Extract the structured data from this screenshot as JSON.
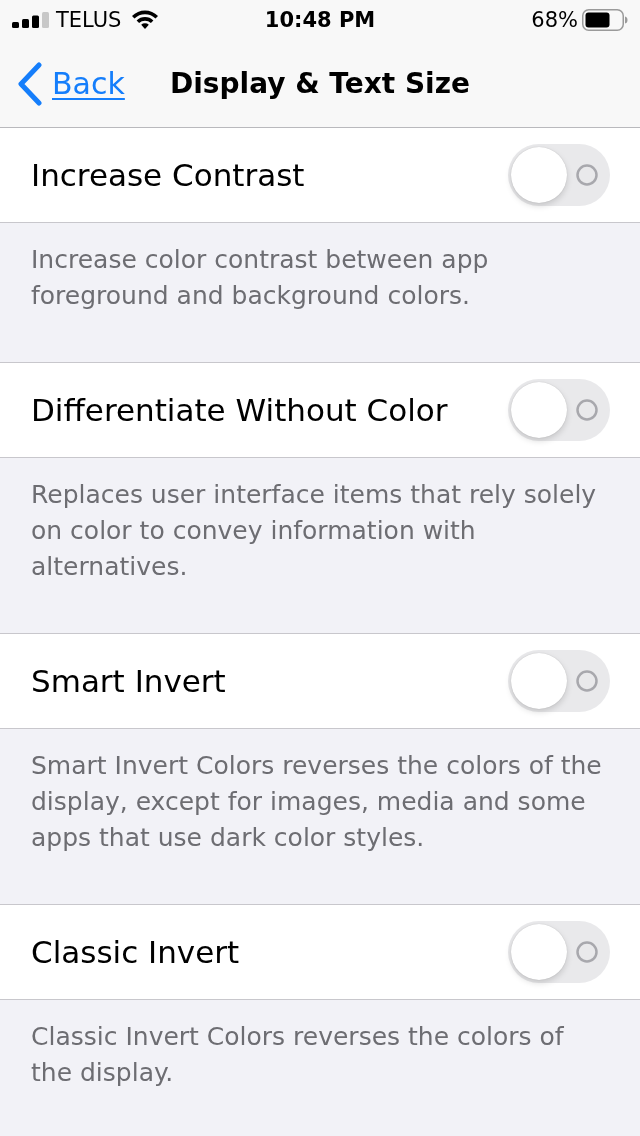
{
  "status_bar": {
    "carrier": "TELUS",
    "time": "10:48 PM",
    "battery": "68%"
  },
  "nav_bar": {
    "back_label": "Back",
    "title": "Display & Text Size"
  },
  "settings": [
    {
      "label": "Increase Contrast",
      "on": false,
      "footer": "Increase color contrast between app foreground and background colors."
    },
    {
      "label": "Differentiate Without Color",
      "on": false,
      "footer": "Replaces user interface items that rely solely on color to convey information with alternatives."
    },
    {
      "label": "Smart Invert",
      "on": false,
      "footer": "Smart Invert Colors reverses the colors of the display, except for images, media and some apps that use dark color styles."
    },
    {
      "label": "Classic Invert",
      "on": false,
      "footer": "Classic Invert Colors reverses the colors of the display."
    }
  ]
}
